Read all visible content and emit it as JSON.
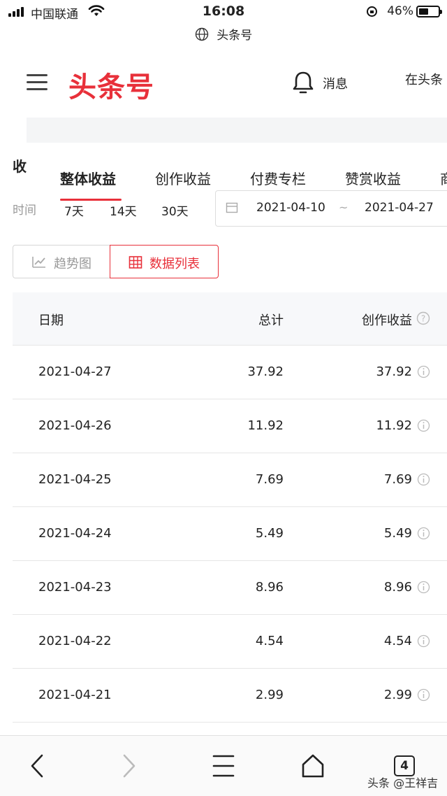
{
  "status_bar": {
    "carrier": "中国联通",
    "time": "16:08",
    "battery": "46%"
  },
  "url_bar": {
    "site": "头条号"
  },
  "header": {
    "logo": "头条号",
    "messages_label": "消息",
    "publish_label": "在头条"
  },
  "revenue": {
    "section_label": "收",
    "tabs": [
      {
        "label": "整体收益",
        "active": true
      },
      {
        "label": "创作收益",
        "active": false
      },
      {
        "label": "付费专栏",
        "active": false
      },
      {
        "label": "赞赏收益",
        "active": false
      },
      {
        "label": "商",
        "active": false
      }
    ],
    "time_label": "时间",
    "ranges": [
      "7天",
      "14天",
      "30天"
    ],
    "date_start": "2021-04-10",
    "date_separator": "~",
    "date_end": "2021-04-27"
  },
  "view_toggle": {
    "trend_label": "趋势图",
    "table_label": "数据列表",
    "selected": "table"
  },
  "table": {
    "columns": {
      "date": "日期",
      "total": "总计",
      "creation": "创作收益"
    },
    "rows": [
      {
        "date": "2021-04-27",
        "total": "37.92",
        "creation": "37.92"
      },
      {
        "date": "2021-04-26",
        "total": "11.92",
        "creation": "11.92"
      },
      {
        "date": "2021-04-25",
        "total": "7.69",
        "creation": "7.69"
      },
      {
        "date": "2021-04-24",
        "total": "5.49",
        "creation": "5.49"
      },
      {
        "date": "2021-04-23",
        "total": "8.96",
        "creation": "8.96"
      },
      {
        "date": "2021-04-22",
        "total": "4.54",
        "creation": "4.54"
      },
      {
        "date": "2021-04-21",
        "total": "2.99",
        "creation": "2.99"
      }
    ]
  },
  "bottom_bar": {
    "tab_count": "4",
    "watermark": "头条 @王祥吉"
  },
  "colors": {
    "accent": "#e8303a",
    "muted": "#999999",
    "row_border": "#e6e6e6"
  }
}
